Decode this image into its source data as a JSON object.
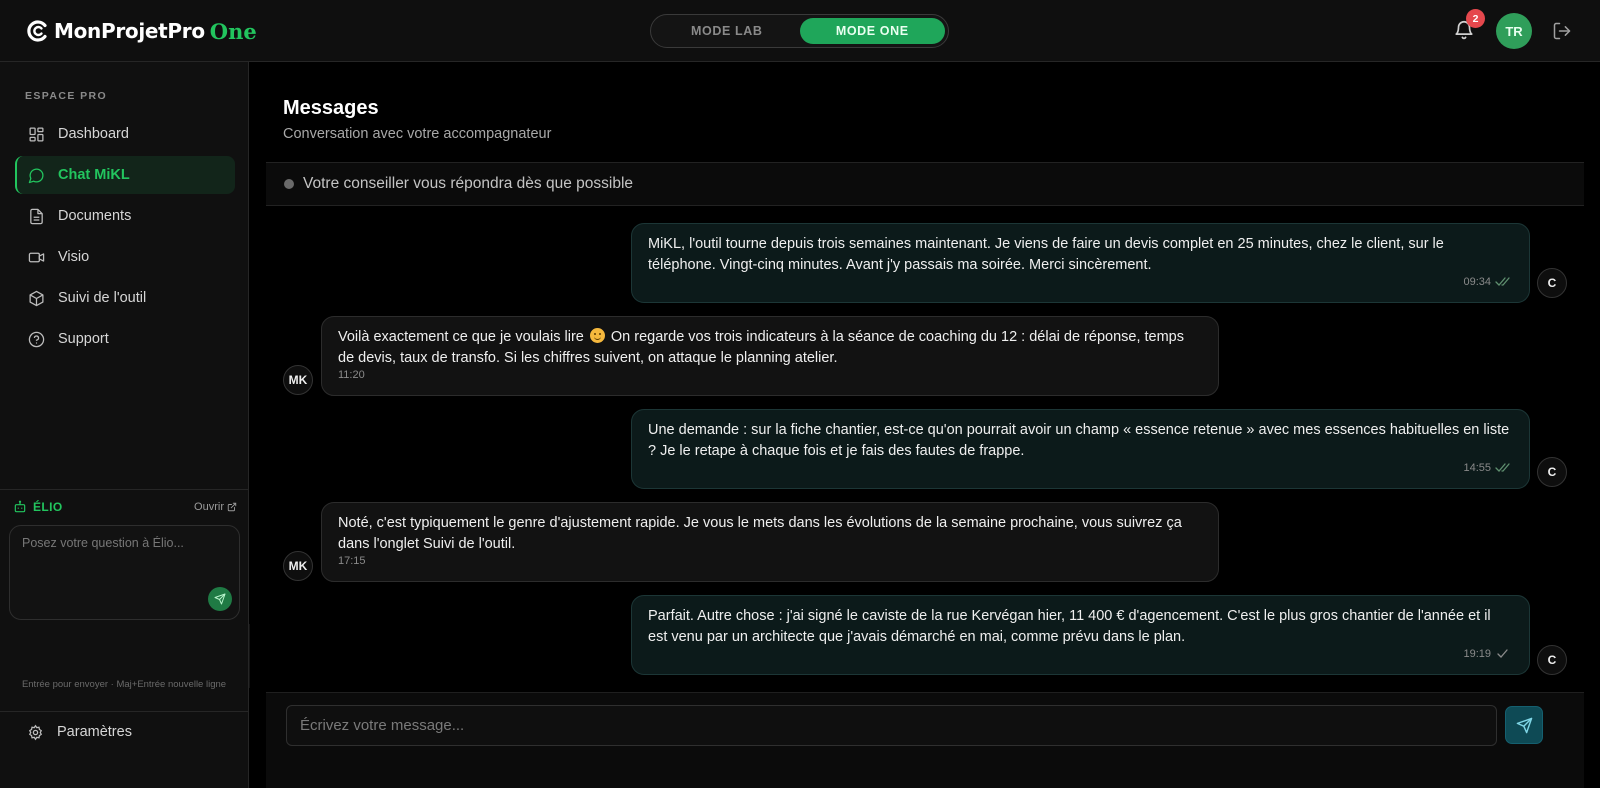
{
  "brand": {
    "name": "MonProjetPro",
    "suffix": "One"
  },
  "modes": [
    {
      "label": "MODE LAB",
      "active": false
    },
    {
      "label": "MODE ONE",
      "active": true
    }
  ],
  "header": {
    "notifications_count": "2",
    "user_initials": "TR"
  },
  "sidebar": {
    "section_label": "ESPACE PRO",
    "items": [
      {
        "label": "Dashboard",
        "icon": "dashboard-icon",
        "active": false
      },
      {
        "label": "Chat MiKL",
        "icon": "chat-icon",
        "active": true
      },
      {
        "label": "Documents",
        "icon": "document-icon",
        "active": false
      },
      {
        "label": "Visio",
        "icon": "video-icon",
        "active": false
      },
      {
        "label": "Suivi de l'outil",
        "icon": "cube-icon",
        "active": false
      },
      {
        "label": "Support",
        "icon": "help-icon",
        "active": false
      }
    ],
    "elio": {
      "title": "ÉLIO",
      "open_label": "Ouvrir",
      "placeholder": "Posez votre question à Élio...",
      "hint": "Entrée pour envoyer · Maj+Entrée nouvelle ligne"
    },
    "settings_label": "Paramètres"
  },
  "page": {
    "title": "Messages",
    "subtitle": "Conversation avec votre accompagnateur",
    "status": "Votre conseiller vous répondra dès que possible"
  },
  "messages": [
    {
      "from": "user",
      "avatar": "C",
      "text": "MiKL, l'outil tourne depuis trois semaines maintenant. Je viens de faire un devis complet en 25 minutes, chez le client, sur le téléphone. Vingt-cinq minutes. Avant j'y passais ma soirée. Merci sincèrement.",
      "time": "09:34",
      "read": true
    },
    {
      "from": "coach",
      "avatar": "MK",
      "text_before_emoji": "Voilà exactement ce que je voulais lire",
      "text_after_emoji": " On regarde vos trois indicateurs à la séance de coaching du 12 : délai de réponse, temps de devis, taux de transfo. Si les chiffres suivent, on attaque le planning atelier.",
      "time": "11:20"
    },
    {
      "from": "user",
      "avatar": "C",
      "text": "Une demande : sur la fiche chantier, est-ce qu'on pourrait avoir un champ « essence retenue » avec mes essences habituelles en liste ? Je le retape à chaque fois et je fais des fautes de frappe.",
      "time": "14:55",
      "read": true
    },
    {
      "from": "coach",
      "avatar": "MK",
      "text": "Noté, c'est typiquement le genre d'ajustement rapide. Je vous le mets dans les évolutions de la semaine prochaine, vous suivrez ça dans l'onglet Suivi de l'outil.",
      "time": "17:15"
    },
    {
      "from": "user",
      "avatar": "C",
      "text": "Parfait. Autre chose : j'ai signé le caviste de la rue Kervégan hier, 11 400 € d'agencement. C'est le plus gros chantier de l'année et il est venu par un architecte que j'avais démarché en mai, comme prévu dans le plan.",
      "time": "19:19",
      "read": false
    }
  ],
  "composer": {
    "placeholder": "Écrivez votre message..."
  },
  "colors": {
    "accent": "#22c55e",
    "user_bubble": "#0c1a1a",
    "coach_bubble": "#121212",
    "badge": "#e5484d"
  }
}
